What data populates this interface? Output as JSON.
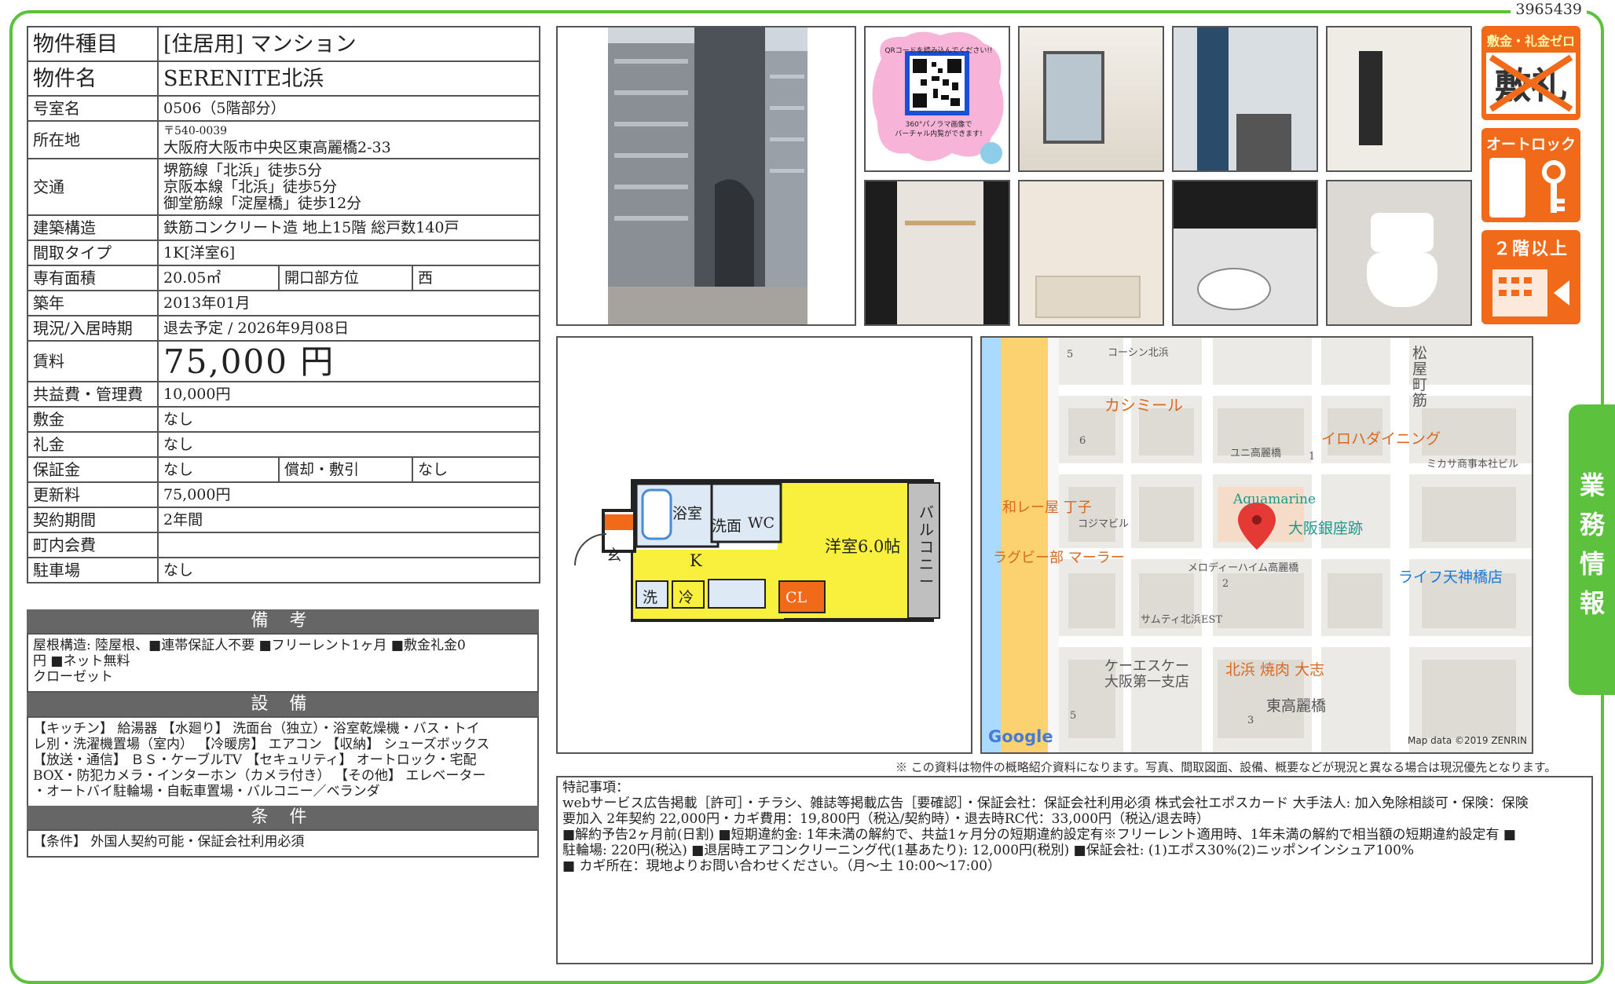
{
  "doc_id": "3965439",
  "spec": {
    "type_label": "物件種目",
    "type_value": "[住居用] マンション",
    "name_label": "物件名",
    "name_value": "SERENITE北浜",
    "room_label": "号室名",
    "room_value": "0506（5階部分）",
    "addr_label": "所在地",
    "addr_zip": "〒540-0039",
    "addr_value": "大阪府大阪市中央区東高麗橋2-33",
    "traffic_label": "交通",
    "traffic_1": "堺筋線「北浜」徒歩5分",
    "traffic_2": "京阪本線「北浜」徒歩5分",
    "traffic_3": "御堂筋線「淀屋橋」徒歩12分",
    "structure_label": "建築構造",
    "structure_value": "鉄筋コンクリート造 地上15階 総戸数140戸",
    "layout_label": "間取タイプ",
    "layout_value": "1K[洋室6]",
    "area_label": "専有面積",
    "area_value": "20.05㎡",
    "direction_label": "開口部方位",
    "direction_value": "西",
    "built_label": "築年",
    "built_value": "2013年01月",
    "status_label": "現況/入居時期",
    "status_value": "退去予定 / 2026年9月08日",
    "rent_label": "賃料",
    "rent_value": "75,000 円",
    "fee_label": "共益費・管理費",
    "fee_value": "10,000円",
    "deposit_label": "敷金",
    "deposit_value": "なし",
    "key_label": "礼金",
    "key_value": "なし",
    "guarantee_label": "保証金",
    "guarantee_value": "なし",
    "amort_label": "償却・敷引",
    "amort_value": "なし",
    "renewal_label": "更新料",
    "renewal_value": "75,000円",
    "term_label": "契約期間",
    "term_value": "2年間",
    "town_label": "町内会費",
    "town_value": "",
    "parking_label": "駐車場",
    "parking_value": "なし"
  },
  "remarks": {
    "title": "備 考",
    "body_1": "屋根構造: 陸屋根、■連帯保証人不要 ■フリーレント1ヶ月 ■敷金礼金0",
    "body_2": "円 ■ネット無料",
    "body_3": "クローゼット"
  },
  "equipment": {
    "title": "設 備",
    "body_1": "【キッチン】 給湯器 【水廻り】 洗面台（独立）・浴室乾燥機・バス・トイ",
    "body_2": "レ別・洗濯機置場（室内） 【冷暖房】 エアコン 【収納】 シューズボックス",
    "body_3": "【放送・通信】 ＢＳ・ケーブルTV 【セキュリティ】 オートロック・宅配",
    "body_4": "BOX・防犯カメラ・インターホン（カメラ付き） 【その他】 エレベーター",
    "body_5": "・オートバイ駐輪場・自転車置場・バルコニー／ベランダ"
  },
  "conditions": {
    "title": "条 件",
    "body": "【条件】 外国人契約可能・保証会社利用必須"
  },
  "qr": {
    "line1": "QRコードを読み込んでください!!",
    "line2": "360°パノラマ画像で",
    "line3": "バーチャル内覧ができます!"
  },
  "badges": {
    "zero_title": "敷金・礼金ゼロ",
    "zero_chars": "敷礼",
    "autolock_title": "オートロック",
    "floor_title": "２階以上"
  },
  "floorplan": {
    "bath": "浴室",
    "washroom": "洗面",
    "wc": "WC",
    "kitchen": "K",
    "entrance": "玄",
    "laundry": "洗",
    "fridge": "冷",
    "closet": "CL",
    "room": "洋室6.0帖",
    "balcony": "バルコニー"
  },
  "map": {
    "street_v": "松屋町筋",
    "l_coshin": "コーシン北浜",
    "l_kashimir": "カシミール",
    "l_iroha": "イロハダイニング",
    "l_uni": "ユニ高麗橋",
    "l_mikasa": "ミカサ商事本社ビル",
    "l_wakare": "和レー屋 丁子",
    "l_kojima": "コジマビル",
    "l_aquamarine": "Aquamarine",
    "l_ginza": "大阪銀座跡",
    "l_rugby": "ラグビー部 マーラー",
    "l_melody": "メロディーハイム高麗橋",
    "l_life": "ライフ天神橋店",
    "l_samty": "サムティ北浜EST",
    "l_ks": "ケーエスケー",
    "l_ks2": "大阪第一支店",
    "l_yakiniku": "北浜 焼肉 大志",
    "l_higashi": "東高麗橋",
    "n5a": "5",
    "n6": "6",
    "n1": "1",
    "n2": "2",
    "n5b": "5",
    "n3": "3",
    "google": "Google",
    "credit": "Map data ©2019 ZENRIN"
  },
  "disclaimer": "※ この資料は物件の概略紹介資料になります。写真、間取図面、設備、概要などが現況と異なる場合は現況優先となります。",
  "special_notes": {
    "title": "特記事項：",
    "line1": "webサービス広告掲載［許可］・チラシ、雑誌等掲載広告［要確認］・保証会社：保証会社利用必須 株式会社エポスカード 大手法人: 加入免除相談可・保険：保険",
    "line2": "要加入 2年契約 22,000円・カギ費用：19,800円（税込/契約時）・退去時RC代：33,000円（税込/退去時）",
    "line3": "■解約予告2ヶ月前(日割) ■短期違約金: 1年未満の解約で、共益1ヶ月分の短期違約設定有※フリーレント適用時、1年未満の解約で相当額の短期違約設定有 ■",
    "line4": "駐輪場: 220円(税込) ■退居時エアコンクリーニング代(1基あたり): 12,000円(税別) ■保証会社: (1)エポス30%(2)ニッポンインシュア100%",
    "line5": "■ カギ所在：現地よりお問い合わせください。（月～土 10:00～17:00）"
  },
  "side_tab": "業務情報",
  "colors": {
    "green": "#5cc23e",
    "orange": "#f06a1a",
    "yellow": "#f8f03c",
    "header_gray": "#666666"
  }
}
